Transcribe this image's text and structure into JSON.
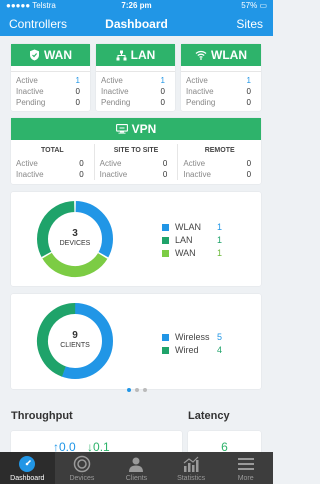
{
  "status_bar": {
    "carrier": "●●●●● Telstra",
    "time": "7:26 pm",
    "battery": "57%"
  },
  "nav": {
    "left": "Controllers",
    "title": "Dashboard",
    "right": "Sites"
  },
  "wan": {
    "title": "WAN",
    "rows": [
      {
        "label": "Active",
        "value": "1"
      },
      {
        "label": "Inactive",
        "value": "0"
      },
      {
        "label": "Pending",
        "value": "0"
      }
    ]
  },
  "lan": {
    "title": "LAN",
    "rows": [
      {
        "label": "Active",
        "value": "1"
      },
      {
        "label": "Inactive",
        "value": "0"
      },
      {
        "label": "Pending",
        "value": "0"
      }
    ]
  },
  "wlan": {
    "title": "WLAN",
    "rows": [
      {
        "label": "Active",
        "value": "1"
      },
      {
        "label": "Inactive",
        "value": "0"
      },
      {
        "label": "Pending",
        "value": "0"
      }
    ]
  },
  "vpn": {
    "title": "VPN",
    "columns": [
      {
        "heading": "TOTAL",
        "rows": [
          {
            "label": "Active",
            "value": "0"
          },
          {
            "label": "Inactive",
            "value": "0"
          }
        ]
      },
      {
        "heading": "SITE TO SITE",
        "rows": [
          {
            "label": "Active",
            "value": "0"
          },
          {
            "label": "Inactive",
            "value": "0"
          }
        ]
      },
      {
        "heading": "REMOTE",
        "rows": [
          {
            "label": "Active",
            "value": "0"
          },
          {
            "label": "Inactive",
            "value": "0"
          }
        ]
      }
    ]
  },
  "devices": {
    "count": "3",
    "label": "DEVICES",
    "legend": [
      {
        "name": "WLAN",
        "value": "1",
        "color": "#2196e6"
      },
      {
        "name": "LAN",
        "value": "1",
        "color": "#1fa36a"
      },
      {
        "name": "WAN",
        "value": "1",
        "color": "#7ccc44"
      }
    ]
  },
  "clients": {
    "count": "9",
    "label": "CLIENTS",
    "legend": [
      {
        "name": "Wireless",
        "value": "5",
        "color": "#2196e6"
      },
      {
        "name": "Wired",
        "value": "4",
        "color": "#1fa36a"
      }
    ]
  },
  "sections": {
    "throughput": "Throughput",
    "latency": "Latency",
    "throughput_up": "0.0",
    "throughput_down": "0.1",
    "latency_value": "6"
  },
  "tabs": [
    {
      "label": "Dashboard",
      "icon": "dashboard-icon"
    },
    {
      "label": "Devices",
      "icon": "devices-icon"
    },
    {
      "label": "Clients",
      "icon": "clients-icon"
    },
    {
      "label": "Statistics",
      "icon": "statistics-icon"
    },
    {
      "label": "More",
      "icon": "more-icon"
    }
  ],
  "colors": {
    "accent": "#2196e6",
    "green": "#2eb36b",
    "dark_green": "#1fa36a",
    "light_green": "#7ccc44"
  }
}
